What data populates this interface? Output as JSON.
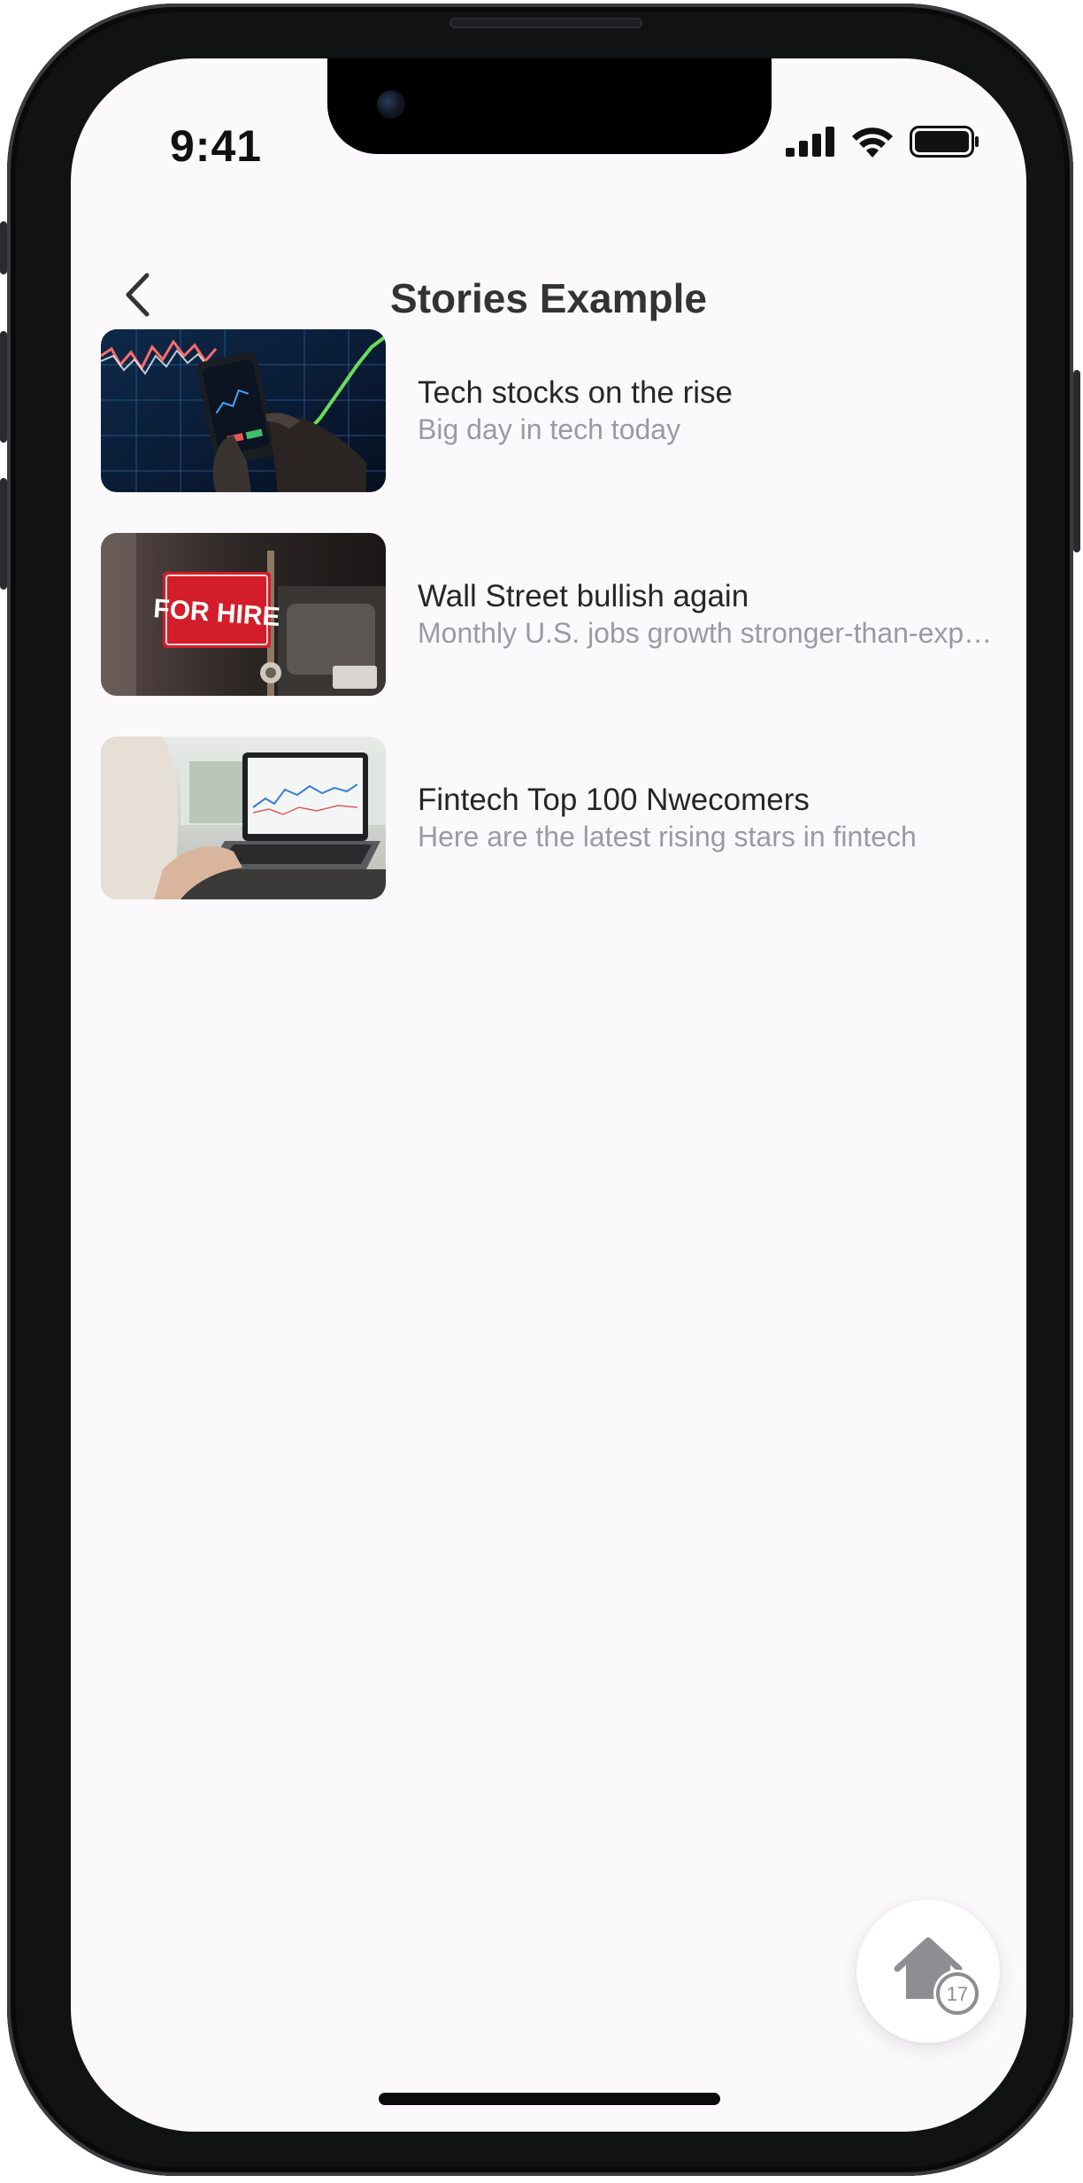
{
  "status_bar": {
    "time": "9:41",
    "icons": [
      "cellular-signal-icon",
      "wifi-icon",
      "battery-icon"
    ]
  },
  "header": {
    "title": "Stories Example",
    "back_icon": "chevron-left-icon"
  },
  "stories": [
    {
      "title": "Tech stocks on the rise",
      "subtitle": "Big day in tech today",
      "thumbnail": "stock-chart-phone-photo"
    },
    {
      "title": "Wall Street bullish again",
      "subtitle": "Monthly U.S. jobs growth stronger-than-expected",
      "thumbnail": "for-hire-sign-photo",
      "thumbnail_text": "FOR HIRE"
    },
    {
      "title": "Fintech Top 100 Nwecomers",
      "subtitle": "Here are the latest rising stars in fintech",
      "thumbnail": "laptop-chart-photo"
    }
  ],
  "fab": {
    "icon": "home-icon",
    "badge": "17"
  },
  "colors": {
    "background": "#fbf9fc",
    "title_text": "#333335",
    "story_title": "#262628",
    "story_subtitle": "#9b9a9f"
  }
}
